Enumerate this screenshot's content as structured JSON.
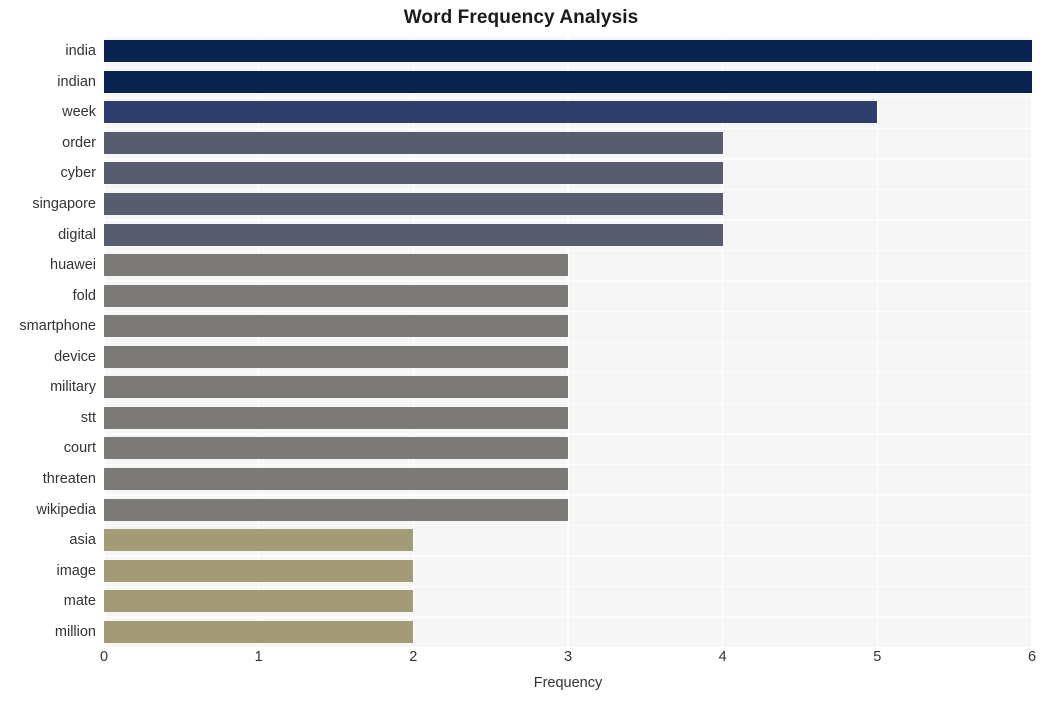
{
  "chart_data": {
    "type": "bar",
    "orientation": "horizontal",
    "title": "Word Frequency Analysis",
    "xlabel": "Frequency",
    "ylabel": "",
    "categories": [
      "india",
      "indian",
      "week",
      "order",
      "cyber",
      "singapore",
      "digital",
      "huawei",
      "fold",
      "smartphone",
      "device",
      "military",
      "stt",
      "court",
      "threaten",
      "wikipedia",
      "asia",
      "image",
      "mate",
      "million"
    ],
    "values": [
      6,
      6,
      5,
      4,
      4,
      4,
      4,
      3,
      3,
      3,
      3,
      3,
      3,
      3,
      3,
      3,
      2,
      2,
      2,
      2
    ],
    "bar_colors": [
      "#062murky",
      "#062murky",
      "#2e3f6d",
      "#575c6e",
      "#575c6e",
      "#575c6e",
      "#575c6e",
      "#7b7a77",
      "#7b7a77",
      "#7b7a77",
      "#7b7a77",
      "#7b7a77",
      "#7b7a77",
      "#7b7a77",
      "#7b7a77",
      "#7b7a77",
      "#a39b75",
      "#a39b75",
      "#a39b75",
      "#a39b75"
    ],
    "xlim": [
      0,
      6
    ],
    "xticks": [
      0,
      1,
      2,
      3,
      4,
      5,
      6
    ],
    "xtick_labels": [
      "0",
      "1",
      "2",
      "3",
      "4",
      "5",
      "6"
    ],
    "grid": true,
    "grid_axis": "x",
    "legend": false,
    "plot_background": "#f6f6f6",
    "figure_background": "#ffffff",
    "gridline_color": "#ffffff",
    "palette": {
      "navy": "#0a2450",
      "blue": "#2e3f6d",
      "slate": "#575c6e",
      "gray": "#7b7a77",
      "khaki": "#a39b75"
    }
  }
}
